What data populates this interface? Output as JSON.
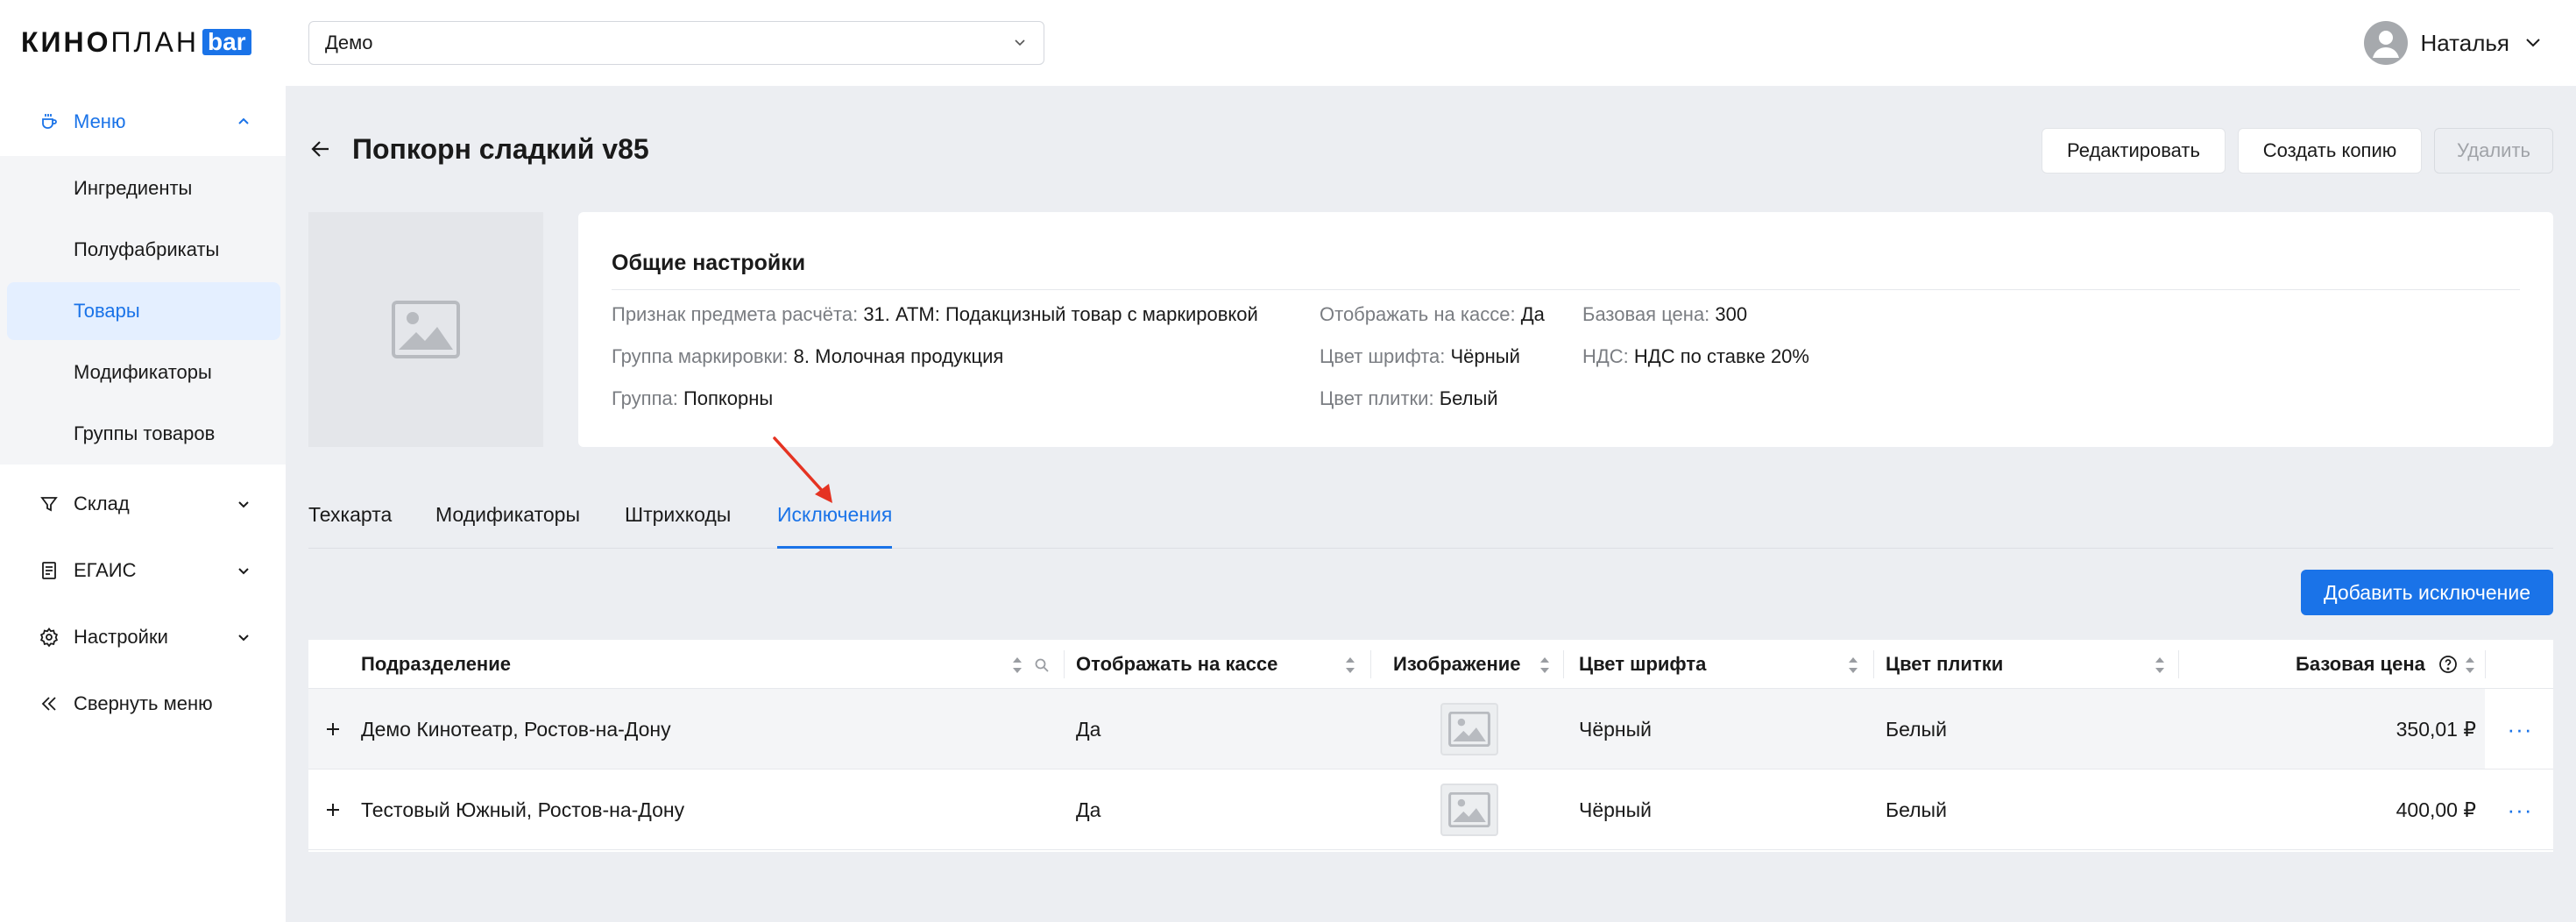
{
  "app": {
    "logo_main": "КИНО",
    "logo_thin": "ПЛАН",
    "logo_badge": "bar"
  },
  "sidebar": {
    "menu_label": "Меню",
    "menu_items": [
      "Ингредиенты",
      "Полуфабрикаты",
      "Товары",
      "Модификаторы",
      "Группы товаров"
    ],
    "selected_item": "Товары",
    "warehouse_label": "Склад",
    "egais_label": "ЕГАИС",
    "settings_label": "Настройки",
    "collapse_label": "Свернуть меню"
  },
  "topbar": {
    "cinema_select_value": "Демо",
    "user_name": "Наталья"
  },
  "header": {
    "title": "Попкорн сладкий v85",
    "edit_label": "Редактировать",
    "copy_label": "Создать копию",
    "delete_label": "Удалить"
  },
  "settings": {
    "title": "Общие настройки",
    "calc_sign_label": "Признак предмета расчёта:",
    "calc_sign_value": "31. АТМ: Подакцизный товар с маркировкой",
    "marking_group_label": "Группа маркировки:",
    "marking_group_value": "8. Молочная продукция",
    "group_label": "Группа:",
    "group_value": "Попкорны",
    "show_on_cashier_label": "Отображать на кассе:",
    "show_on_cashier_value": "Да",
    "font_color_label": "Цвет шрифта:",
    "font_color_value": "Чёрный",
    "tile_color_label": "Цвет плитки:",
    "tile_color_value": "Белый",
    "base_price_label": "Базовая цена:",
    "base_price_value": "300",
    "vat_label": "НДС:",
    "vat_value": "НДС по ставке 20%"
  },
  "tabs": [
    "Техкарта",
    "Модификаторы",
    "Штрихкоды",
    "Исключения"
  ],
  "active_tab": "Исключения",
  "add_exception_label": "Добавить исключение",
  "table": {
    "columns": {
      "division": "Подразделение",
      "show_on_cashier": "Отображать на кассе",
      "image": "Изображение",
      "font_color": "Цвет шрифта",
      "tile_color": "Цвет плитки",
      "base_price": "Базовая цена"
    },
    "rows": [
      {
        "division": "Демо Кинотеатр, Ростов-на-Дону",
        "show_on_cashier": "Да",
        "font_color": "Чёрный",
        "tile_color": "Белый",
        "base_price": "350,01 ₽"
      },
      {
        "division": "Тестовый Южный, Ростов-на-Дону",
        "show_on_cashier": "Да",
        "font_color": "Чёрный",
        "tile_color": "Белый",
        "base_price": "400,00 ₽"
      }
    ]
  },
  "colors": {
    "accent": "#1a73e8",
    "annotation_arrow": "#e53322",
    "background": "#eceef2"
  }
}
